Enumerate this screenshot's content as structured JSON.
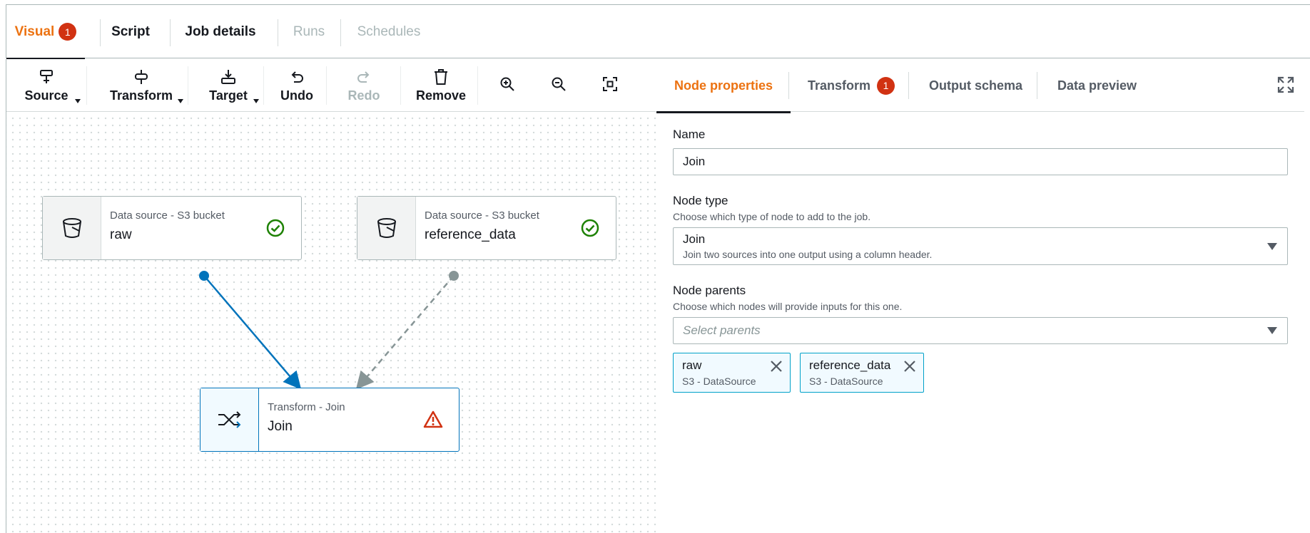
{
  "top_tabs": [
    {
      "label": "Visual",
      "badge": "1"
    },
    {
      "label": "Script"
    },
    {
      "label": "Job details"
    },
    {
      "label": "Runs"
    },
    {
      "label": "Schedules"
    }
  ],
  "toolbar": {
    "source": "Source",
    "transform": "Transform",
    "target": "Target",
    "undo": "Undo",
    "redo": "Redo",
    "remove": "Remove",
    "icons": [
      "zoom-in-icon",
      "zoom-out-icon",
      "fit-view-icon"
    ]
  },
  "nodes": {
    "raw": {
      "sub": "Data source - S3 bucket",
      "title": "raw",
      "status": "success"
    },
    "reference": {
      "sub": "Data source - S3 bucket",
      "title": "reference_data",
      "status": "success"
    },
    "join": {
      "sub": "Transform - Join",
      "title": "Join",
      "status": "warning"
    }
  },
  "panel": {
    "tabs": [
      {
        "label": "Node properties"
      },
      {
        "label": "Transform",
        "badge": "1"
      },
      {
        "label": "Output schema"
      },
      {
        "label": "Data preview"
      }
    ],
    "name_label": "Name",
    "name_value": "Join",
    "node_type_label": "Node type",
    "node_type_desc": "Choose which type of node to add to the job.",
    "node_type_value": "Join",
    "node_type_value_desc": "Join two sources into one output using a column header.",
    "parents_label": "Node parents",
    "parents_desc": "Choose which nodes will provide inputs for this one.",
    "parents_placeholder": "Select parents",
    "tokens": [
      {
        "title": "raw",
        "sub": "S3 - DataSource"
      },
      {
        "title": "reference_data",
        "sub": "S3 - DataSource"
      }
    ]
  },
  "colors": {
    "accent": "#ec7211",
    "badge": "#d13212",
    "selected": "#0073bb",
    "success": "#1d8102",
    "warning": "#d13212"
  }
}
